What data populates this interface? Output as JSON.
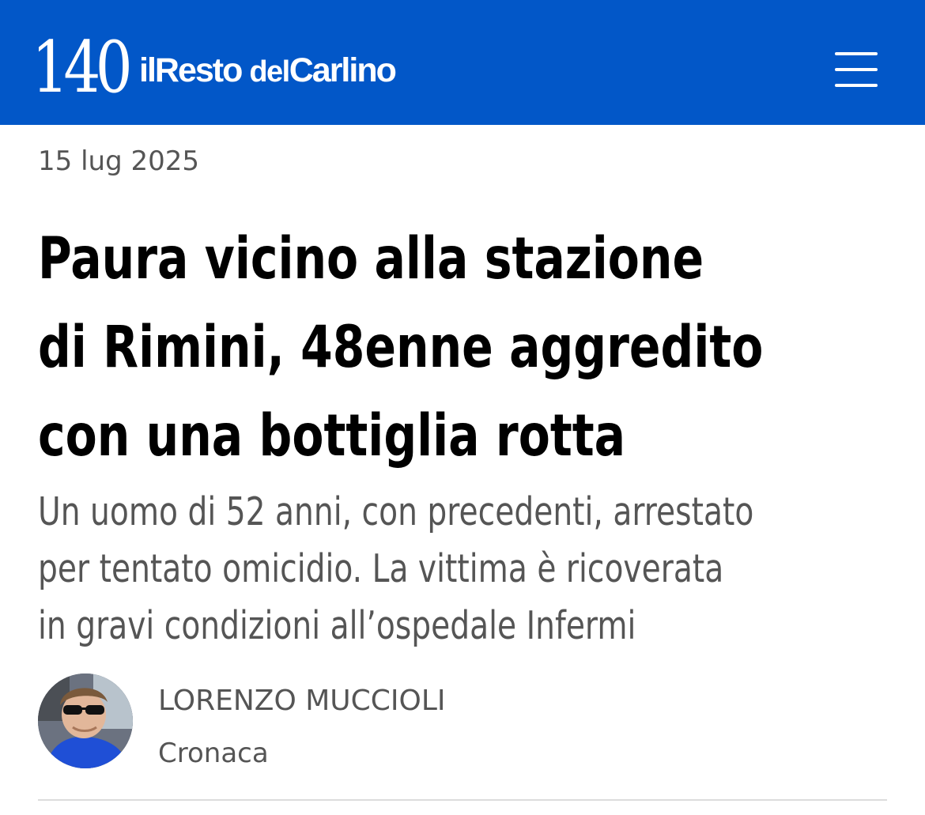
{
  "header": {
    "logo_number": "140",
    "logo_words": [
      "il",
      "Resto",
      "del",
      "Carlino"
    ],
    "background_color": "#0257c8",
    "menu_icon": "hamburger-menu-icon"
  },
  "article": {
    "date": "15 lug 2025",
    "headline_lines": [
      "Paura vicino alla stazione",
      "di Rimini, 48enne aggredito",
      "con una bottiglia rotta"
    ],
    "subtitle_lines": [
      "Un uomo di 52 anni, con precedenti, arrestato",
      "per tentato omicidio. La vittima è ricoverata",
      "in gravi condizioni all’ospedale Infermi"
    ]
  },
  "author": {
    "name": "LORENZO MUCCIOLI",
    "category": "Cronaca"
  }
}
